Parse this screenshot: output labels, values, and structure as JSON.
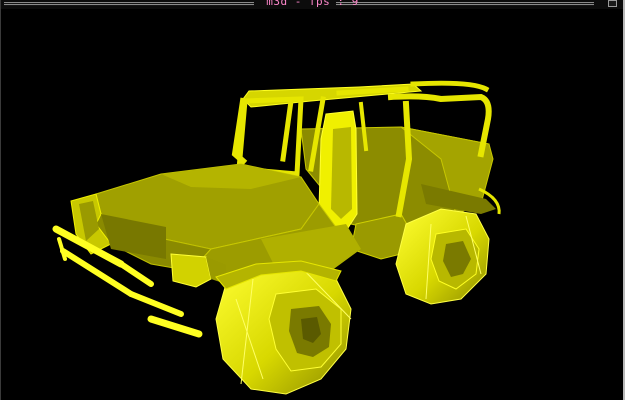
{
  "window": {
    "title": "m3d - fps : 9"
  },
  "viewport": {
    "model_color": "#e6e600",
    "background_color": "#000000"
  },
  "icons": {
    "close": "close-icon"
  }
}
